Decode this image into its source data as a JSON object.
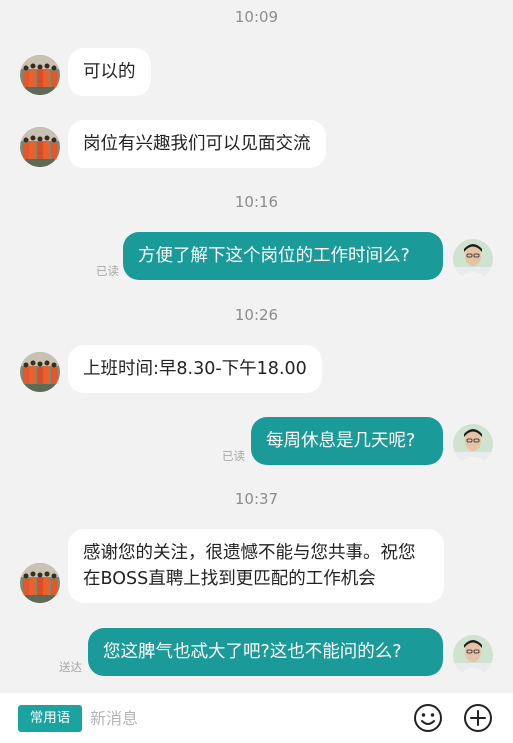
{
  "messages": {
    "t1": "10:09",
    "m1": "可以的",
    "m2": "岗位有兴趣我们可以见面交流",
    "t2": "10:16",
    "m3": "方便了解下这个岗位的工作时间么?",
    "s3": "已读",
    "t3": "10:26",
    "m4": "上班时间:早8.30-下午18.00",
    "m5": "每周休息是几天呢?",
    "s5": "已读",
    "t4": "10:37",
    "m6": "感谢您的关注，很遗憾不能与您共事。祝您在BOSS直聘上找到更匹配的工作机会",
    "m7": "您这脾气也忒大了吧?这也不能问的么?",
    "s7": "送达"
  },
  "bottom_bar": {
    "quick_phrases_label": "常用语",
    "input_placeholder": "新消息",
    "emoji_icon": "emoji-icon",
    "add_icon": "plus-circle-icon"
  },
  "colors": {
    "outgoing_bubble": "#1a9b9a",
    "incoming_bubble": "#ffffff",
    "background": "#f2f2f2",
    "quick_button": "#1aa39f"
  }
}
